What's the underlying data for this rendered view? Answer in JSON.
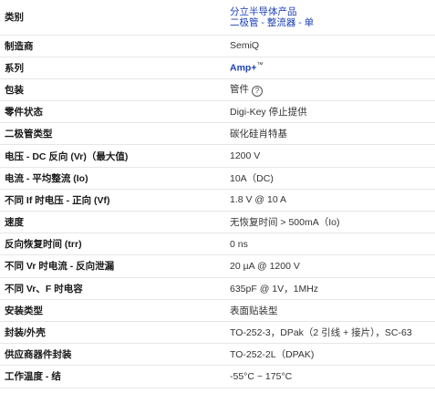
{
  "rows": [
    {
      "label": "类别",
      "links": [
        "分立半导体产品",
        "二极管 - 整流器 - 单"
      ]
    },
    {
      "label": "制造商",
      "value": "SemiQ"
    },
    {
      "label": "系列",
      "series": "Amp+",
      "tm": "™"
    },
    {
      "label": "包装",
      "value": "管件",
      "help": "?"
    },
    {
      "label": "零件状态",
      "value": "Digi-Key 停止提供"
    },
    {
      "label": "二极管类型",
      "value": "碳化硅肖特基"
    },
    {
      "label": "电压 - DC 反向 (Vr)（最大值)",
      "value": "1200 V"
    },
    {
      "label": "电流 - 平均整流 (Io)",
      "value": "10A（DC)"
    },
    {
      "label": "不同 If 时电压 - 正向 (Vf)",
      "value": "1.8 V @ 10 A"
    },
    {
      "label": "速度",
      "value": "无恢复时间 > 500mA（Io)"
    },
    {
      "label": "反向恢复时间 (trr)",
      "value": "0 ns"
    },
    {
      "label": "不同 Vr 时电流 - 反向泄漏",
      "value": "20 µA @ 1200 V"
    },
    {
      "label": "不同 Vr、F 时电容",
      "value": "635pF @ 1V，1MHz"
    },
    {
      "label": "安装类型",
      "value": "表面贴装型"
    },
    {
      "label": "封装/外壳",
      "value": "TO-252-3，DPak（2 引线 + 接片），SC-63"
    },
    {
      "label": "供应商器件封装",
      "value": "TO-252-2L（DPAK)"
    },
    {
      "label": "工作温度 - 结",
      "value": "-55°C ~ 175°C"
    }
  ]
}
